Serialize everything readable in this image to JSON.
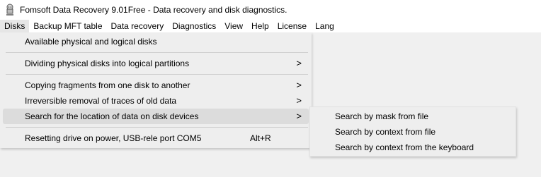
{
  "window": {
    "title": "Fomsoft Data Recovery 9.01Free - Data recovery and disk diagnostics."
  },
  "menubar": {
    "items": [
      {
        "label": "Disks"
      },
      {
        "label": "Backup MFT table"
      },
      {
        "label": "Data recovery"
      },
      {
        "label": "Diagnostics"
      },
      {
        "label": "View"
      },
      {
        "label": "Help"
      },
      {
        "label": "License"
      },
      {
        "label": "Lang"
      }
    ]
  },
  "disks_menu": {
    "items": [
      {
        "label": "Available physical and logical disks"
      },
      {
        "label": "Dividing physical disks into logical partitions",
        "arrow": ">"
      },
      {
        "label": "Copying fragments from one disk to another",
        "arrow": ">"
      },
      {
        "label": "Irreversible removal of traces of old data",
        "arrow": ">"
      },
      {
        "label": "Search for the location of data on disk devices",
        "arrow": ">"
      },
      {
        "label": "Resetting drive on power, USB-rele port COM5",
        "shortcut": "Alt+R"
      }
    ]
  },
  "search_submenu": {
    "items": [
      {
        "label": "Search by mask from file"
      },
      {
        "label": "Search by context from file"
      },
      {
        "label": "Search by context from the keyboard"
      }
    ]
  }
}
